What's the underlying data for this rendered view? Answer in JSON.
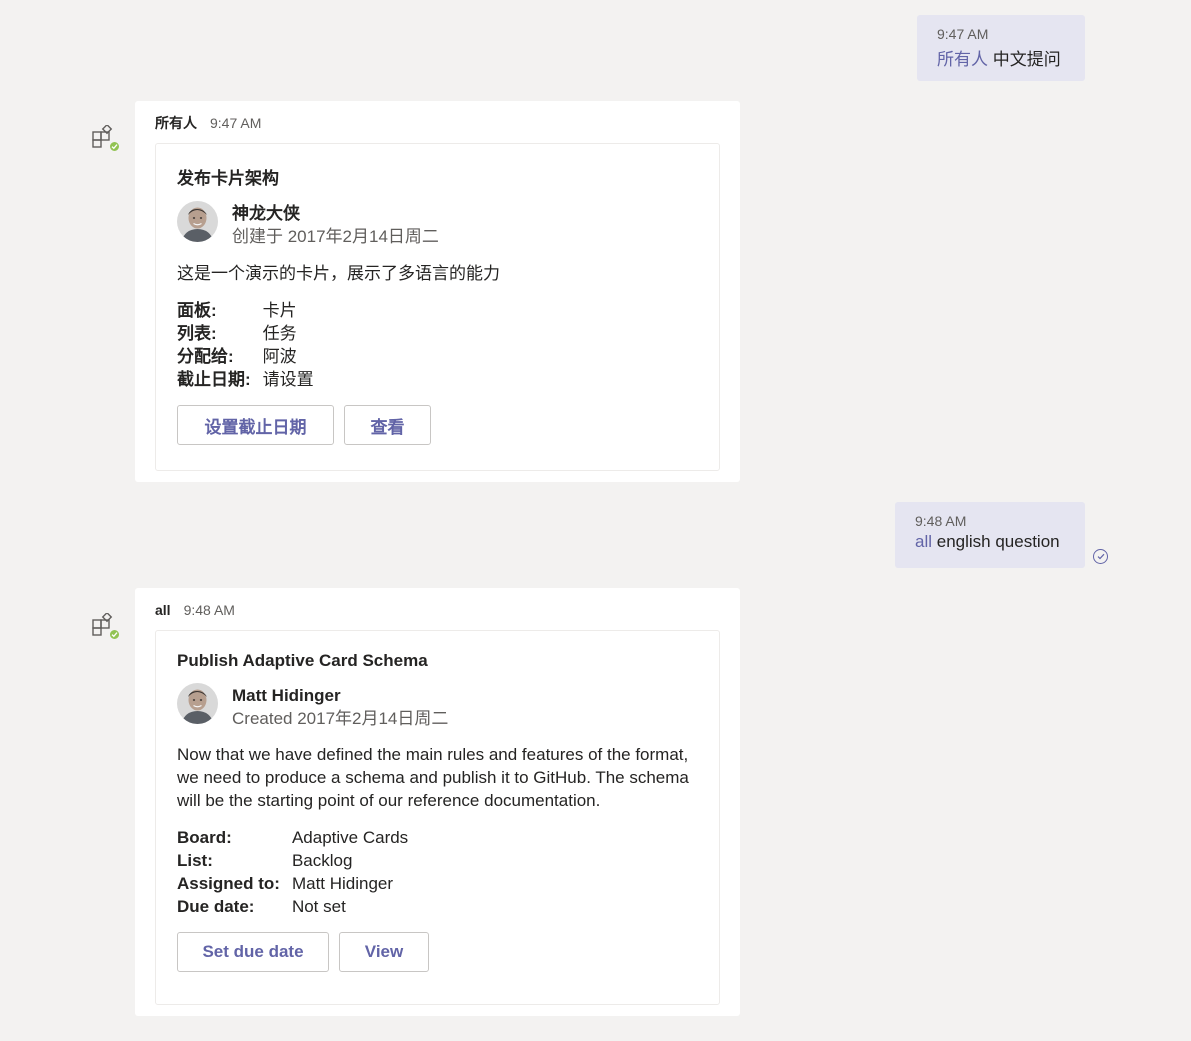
{
  "colors": {
    "accent": "#6264a7",
    "background": "#f3f2f1",
    "sent_bubble": "#e5e5f1",
    "presence": "#92c353"
  },
  "messages": [
    {
      "sent": {
        "time": "9:47 AM",
        "mention": "所有人",
        "text": " 中文提问"
      },
      "reply": {
        "author": "所有人",
        "time": "9:47 AM",
        "bot_icon": "app-bot-icon",
        "card": {
          "title": "发布卡片架构",
          "person_name": "神龙大侠",
          "person_sub": "创建于 2017年2月14日周二",
          "description": "这是一个演示的卡片，展示了多语言的能力",
          "facts": [
            {
              "key": "面板:",
              "value": "卡片"
            },
            {
              "key": "列表:",
              "value": "任务"
            },
            {
              "key": "分配给:",
              "value": "阿波"
            },
            {
              "key": "截止日期:",
              "value": "请设置"
            }
          ],
          "actions": [
            "设置截止日期",
            "查看"
          ]
        }
      }
    },
    {
      "sent": {
        "time": "9:48 AM",
        "mention": "all",
        "text": " english question",
        "status_icon": "read-check-icon"
      },
      "reply": {
        "author": "all",
        "time": "9:48 AM",
        "bot_icon": "app-bot-icon",
        "card": {
          "title": "Publish Adaptive Card Schema",
          "person_name": "Matt Hidinger",
          "person_sub": "Created 2017年2月14日周二",
          "description": "Now that we have defined the main rules and features of the format, we need to produce a schema and publish it to GitHub. The schema will be the starting point of our reference documentation.",
          "facts": [
            {
              "key": "Board:",
              "value": "Adaptive Cards"
            },
            {
              "key": "List:",
              "value": "Backlog"
            },
            {
              "key": "Assigned to:",
              "value": "Matt Hidinger"
            },
            {
              "key": "Due date:",
              "value": "Not set"
            }
          ],
          "actions": [
            "Set due date",
            "View"
          ]
        }
      }
    }
  ]
}
